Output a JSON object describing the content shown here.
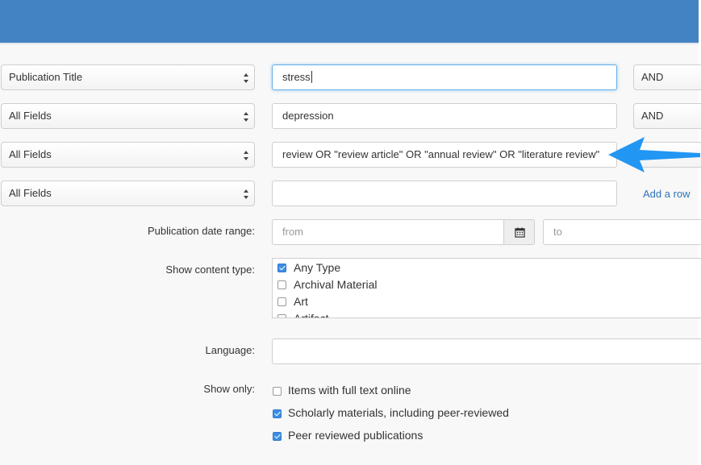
{
  "search_rows": [
    {
      "field": "Publication Title",
      "value": "stress",
      "operator": "AND"
    },
    {
      "field": "All Fields",
      "value": "depression",
      "operator": "AND"
    },
    {
      "field": "All Fields",
      "value": "review OR \"review article\" OR \"annual review\" OR \"literature review\"",
      "operator": ""
    },
    {
      "field": "All Fields",
      "value": "",
      "operator": ""
    }
  ],
  "add_row_label": "Add a row",
  "date_range": {
    "label": "Publication date range:",
    "from_placeholder": "from",
    "to_placeholder": "to"
  },
  "content_type": {
    "label": "Show content type:",
    "items": [
      {
        "label": "Any Type",
        "checked": true
      },
      {
        "label": "Archival Material",
        "checked": false
      },
      {
        "label": "Art",
        "checked": false
      },
      {
        "label": "Artifact",
        "checked": false
      }
    ]
  },
  "language": {
    "label": "Language:"
  },
  "show_only": {
    "label": "Show only:",
    "items": [
      {
        "label": "Items with full text online",
        "checked": false
      },
      {
        "label": "Scholarly materials, including peer-reviewed",
        "checked": true
      },
      {
        "label": "Peer reviewed publications",
        "checked": true
      }
    ]
  },
  "colors": {
    "header": "#4383c3",
    "link": "#2f73bb",
    "checkbox_checked": "#3b8de3",
    "annotation_arrow": "#2196f3"
  }
}
